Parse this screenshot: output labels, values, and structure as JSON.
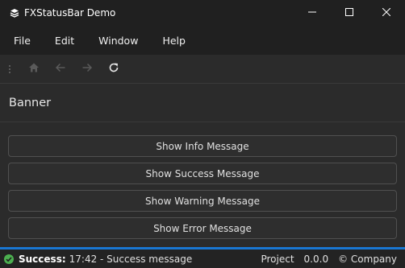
{
  "window": {
    "title": "FXStatusBar Demo",
    "icons": [
      "layers-icon",
      "minimize-icon",
      "maximize-icon",
      "close-icon"
    ]
  },
  "menu": {
    "items": [
      {
        "label": "File"
      },
      {
        "label": "Edit"
      },
      {
        "label": "Window"
      },
      {
        "label": "Help"
      }
    ]
  },
  "toolbar": {
    "icons": [
      "home-icon",
      "back-arrow-icon",
      "forward-arrow-icon",
      "refresh-icon"
    ],
    "home_enabled": false,
    "back_enabled": false,
    "forward_enabled": false,
    "refresh_enabled": true
  },
  "banner": {
    "title": "Banner"
  },
  "buttons": [
    {
      "label": "Show Info Message"
    },
    {
      "label": "Show Success Message"
    },
    {
      "label": "Show Warning Message"
    },
    {
      "label": "Show Error Message"
    }
  ],
  "status": {
    "icon": "check-circle-icon",
    "icon_color": "#4caf50",
    "label": "Success:",
    "message": "17:42 - Success message",
    "project": "Project",
    "version": "0.0.0",
    "company": "© Company",
    "accent_color": "#1976d2"
  }
}
